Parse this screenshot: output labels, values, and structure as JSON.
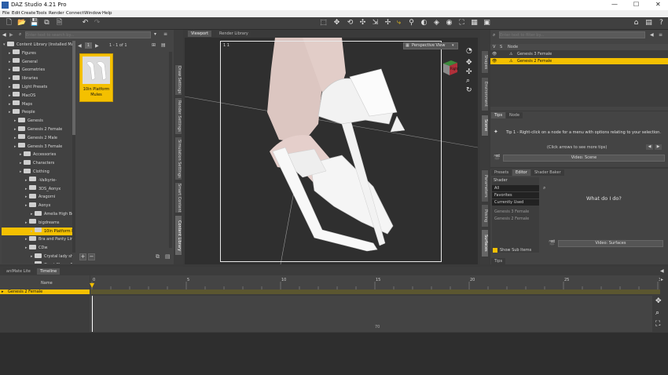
{
  "app": {
    "title": "DAZ Studio 4.21 Pro",
    "window_controls": [
      "—",
      "☐",
      "✕"
    ]
  },
  "menu": [
    "File",
    "Edit",
    "Create",
    "Tools",
    "Render",
    "Connect",
    "Window",
    "Help"
  ],
  "left_panel": {
    "search_placeholder": "Enter text to search by...",
    "page_info": "1 - 1 of 1",
    "tree": [
      {
        "label": "Content Library (Installed Ma...",
        "indent": 0,
        "selected": false
      },
      {
        "label": "Figures",
        "indent": 1,
        "selected": false
      },
      {
        "label": "General",
        "indent": 1,
        "selected": false
      },
      {
        "label": "Geometries",
        "indent": 1,
        "selected": false
      },
      {
        "label": "libraries",
        "indent": 1,
        "selected": false
      },
      {
        "label": "Light Presets",
        "indent": 1,
        "selected": false
      },
      {
        "label": "MacOS",
        "indent": 1,
        "selected": false
      },
      {
        "label": "Maps",
        "indent": 1,
        "selected": false
      },
      {
        "label": "People",
        "indent": 1,
        "selected": false
      },
      {
        "label": "Genesis",
        "indent": 2,
        "selected": false
      },
      {
        "label": "Genesis 2 Female",
        "indent": 2,
        "selected": false
      },
      {
        "label": "Genesis 2 Male",
        "indent": 2,
        "selected": false
      },
      {
        "label": "Genesis 3 Female",
        "indent": 2,
        "selected": false
      },
      {
        "label": "Accessories",
        "indent": 3,
        "selected": false
      },
      {
        "label": "Characters",
        "indent": 3,
        "selected": false
      },
      {
        "label": "Clothing",
        "indent": 3,
        "selected": false
      },
      {
        "label": "-Valkyrie-",
        "indent": 4,
        "selected": false
      },
      {
        "label": "3DS_Aonyx",
        "indent": 4,
        "selected": false
      },
      {
        "label": "Aragorni",
        "indent": 4,
        "selected": false
      },
      {
        "label": "Aonyx",
        "indent": 4,
        "selected": false
      },
      {
        "label": "Amelia High Boots",
        "indent": 5,
        "selected": false
      },
      {
        "label": "bigdreams",
        "indent": 4,
        "selected": false
      },
      {
        "label": "10in Platform Mules",
        "indent": 5,
        "selected": true
      },
      {
        "label": "Bra and Panty Ling...",
        "indent": 4,
        "selected": false
      },
      {
        "label": "CDw",
        "indent": 4,
        "selected": false
      },
      {
        "label": "Crystal lady shoes",
        "indent": 5,
        "selected": false
      },
      {
        "label": "Great Charm Boots",
        "indent": 5,
        "selected": false
      }
    ],
    "thumb_label": "10in Platform Mules"
  },
  "left_vtabs": [
    "Draw Settings",
    "Render Settings",
    "Simulation Settings",
    "Smart Content",
    "Content Library"
  ],
  "viewport": {
    "tabs": [
      "Viewport",
      "Render Library"
    ],
    "view_label": "Perspective View",
    "corner_label": "1 1",
    "cube_label": "Right"
  },
  "right_top": {
    "search_placeholder": "Enter text to filter by...",
    "header": [
      "V",
      "S",
      "Node"
    ],
    "rows": [
      {
        "label": "Genesis 3 Female",
        "selected": false
      },
      {
        "label": "Genesis 2 Female",
        "selected": true
      }
    ]
  },
  "right_vtabs": [
    "Scene",
    "Environment",
    "Shapes"
  ],
  "tips": {
    "tabs": [
      "Tips",
      "Node"
    ],
    "tip_text": "Tip 1 - Right-click on a node for a menu with options relating to your selection.",
    "more": "(Click arrows to see more tips)",
    "button": "Video: Scene"
  },
  "surfaces": {
    "tabs": [
      "Presets",
      "Editor",
      "Shader Baker"
    ],
    "list_header": "Shader",
    "list": [
      "All",
      "Favorites",
      "Currently Used"
    ],
    "nodes": [
      "Genesis 2 Female",
      "Genesis 3 Female"
    ],
    "what_label": "What do I do?",
    "button": "Video: Surfaces",
    "show_sub": "Show Sub Items",
    "bottom_tab": "Tips"
  },
  "right_lower_vtabs": [
    "Parameters",
    "Posing",
    "Surfaces"
  ],
  "timeline": {
    "tabs": [
      "aniMate Lite",
      "Timeline"
    ],
    "name_header": "Name",
    "track": "Genesis 2 Female",
    "ticks": [
      "0",
      "5",
      "10",
      "15",
      "20",
      "25",
      "30"
    ],
    "track_marker": "70"
  },
  "colors": {
    "accent": "#f4c000",
    "viewport_bg": "#2f2f2f",
    "panel_bg": "#444444"
  }
}
